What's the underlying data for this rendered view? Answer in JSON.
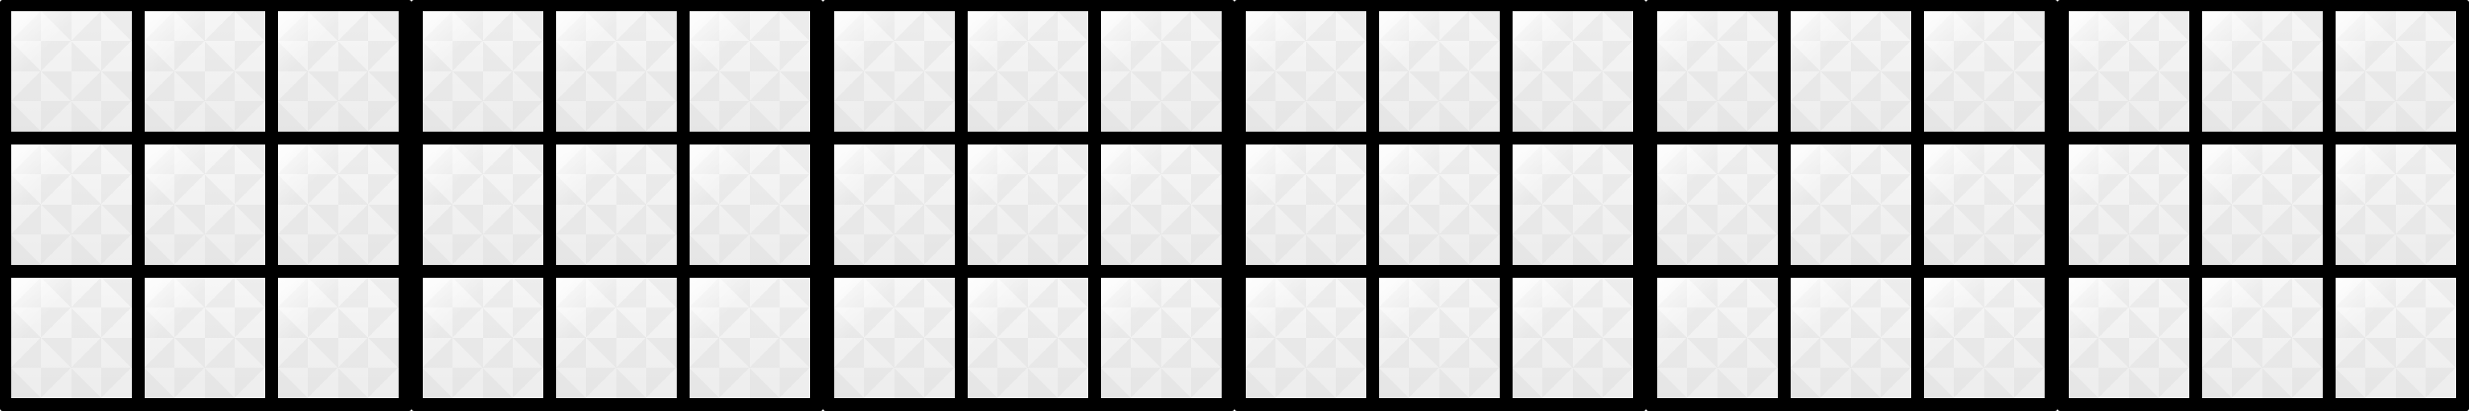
{
  "colors": {
    "grid_line": "#000000",
    "cell_fill": "#f4f4f4",
    "page_background": "#ffffff"
  },
  "boards": [
    {
      "cells": [
        "",
        "",
        "",
        "",
        "",
        "",
        "",
        "",
        ""
      ]
    },
    {
      "cells": [
        "",
        "",
        "",
        "",
        "",
        "",
        "",
        "",
        ""
      ]
    },
    {
      "cells": [
        "",
        "",
        "",
        "",
        "",
        "",
        "",
        "",
        ""
      ]
    },
    {
      "cells": [
        "",
        "",
        "",
        "",
        "",
        "",
        "",
        "",
        ""
      ]
    },
    {
      "cells": [
        "",
        "",
        "",
        "",
        "",
        "",
        "",
        "",
        ""
      ]
    },
    {
      "cells": [
        "",
        "",
        "",
        "",
        "",
        "",
        "",
        "",
        ""
      ]
    }
  ]
}
